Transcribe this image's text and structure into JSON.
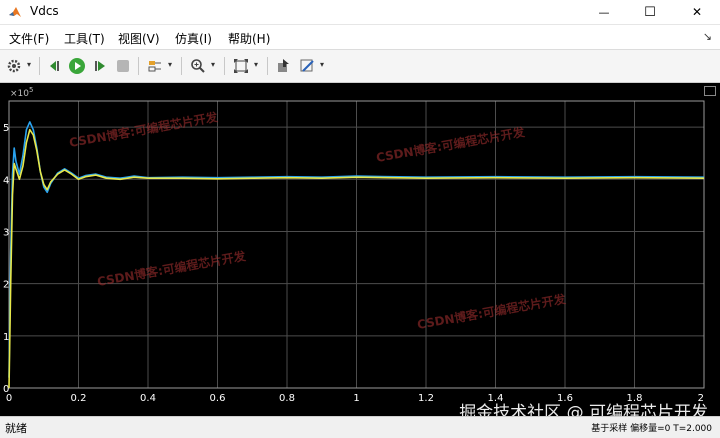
{
  "window": {
    "title": "Vdcs",
    "min_symbol": "—",
    "max_symbol": "☐",
    "close_symbol": "✕"
  },
  "menu": {
    "items": [
      "文件(F)",
      "工具(T)",
      "视图(V)",
      "仿真(I)",
      "帮助(H)"
    ],
    "overflow_symbol": "↘"
  },
  "toolbar": {
    "icons": [
      "gear-icon",
      "rewind-icon",
      "run-icon",
      "step-forward-icon",
      "stop-icon",
      "signal-select-icon",
      "zoom-icon",
      "fit-view-icon",
      "cursor-icon",
      "highlight-icon"
    ]
  },
  "plot": {
    "exponent_label": "×10",
    "exponent_power": "5",
    "background": "#000000",
    "grid_color": "#4d4d4d",
    "axis_text_color": "#ffffff"
  },
  "chart_data": {
    "type": "line",
    "xlim": [
      0,
      2
    ],
    "ylim": [
      0,
      5.5
    ],
    "x_ticks": [
      "0",
      "0.2",
      "0.4",
      "0.6",
      "0.8",
      "1",
      "1.2",
      "1.4",
      "1.6",
      "1.8",
      "2"
    ],
    "y_ticks": [
      "0",
      "1",
      "2",
      "3",
      "4",
      "5"
    ],
    "grid": true,
    "series": [
      {
        "color": "#2aa3f0",
        "x": [
          0,
          0.005,
          0.01,
          0.015,
          0.02,
          0.03,
          0.04,
          0.05,
          0.06,
          0.07,
          0.08,
          0.09,
          0.1,
          0.11,
          0.12,
          0.14,
          0.16,
          0.18,
          0.2,
          0.22,
          0.25,
          0.28,
          0.32,
          0.36,
          0.4,
          0.5,
          0.6,
          0.7,
          0.8,
          0.9,
          1.0,
          1.2,
          1.4,
          1.6,
          1.8,
          2.0
        ],
        "y": [
          0.2,
          2.6,
          4.1,
          4.6,
          4.35,
          4.1,
          4.45,
          4.95,
          5.1,
          4.95,
          4.6,
          4.15,
          3.85,
          3.75,
          3.92,
          4.12,
          4.2,
          4.12,
          4.02,
          4.07,
          4.1,
          4.04,
          4.02,
          4.06,
          4.03,
          4.04,
          4.03,
          4.04,
          4.05,
          4.04,
          4.06,
          4.04,
          4.05,
          4.04,
          4.05,
          4.04
        ]
      },
      {
        "color": "#e8e84a",
        "x": [
          0,
          0.005,
          0.01,
          0.015,
          0.02,
          0.03,
          0.04,
          0.05,
          0.06,
          0.07,
          0.08,
          0.09,
          0.1,
          0.11,
          0.12,
          0.14,
          0.16,
          0.18,
          0.2,
          0.22,
          0.25,
          0.28,
          0.32,
          0.36,
          0.4,
          0.5,
          0.6,
          0.7,
          0.8,
          0.9,
          1.0,
          1.2,
          1.4,
          1.6,
          1.8,
          2.0
        ],
        "y": [
          0.0,
          2.0,
          3.7,
          4.3,
          4.2,
          4.0,
          4.25,
          4.7,
          4.95,
          4.85,
          4.55,
          4.15,
          3.9,
          3.8,
          3.95,
          4.1,
          4.18,
          4.1,
          4.0,
          4.05,
          4.08,
          4.02,
          4.0,
          4.04,
          4.02,
          4.02,
          4.01,
          4.02,
          4.03,
          4.02,
          4.04,
          4.02,
          4.03,
          4.02,
          4.03,
          4.02
        ]
      }
    ]
  },
  "watermarks": [
    "CSDN博客:可编程芯片开发",
    "CSDN博客:可编程芯片开发",
    "CSDN博客:可编程芯片开发",
    "CSDN博客:可编程芯片开发"
  ],
  "corner_watermark": "掘金技术社区 @ 可编程芯片开发",
  "status": {
    "ready": "就绪",
    "right": "基于采样 偏移量=0 T=2.000"
  }
}
